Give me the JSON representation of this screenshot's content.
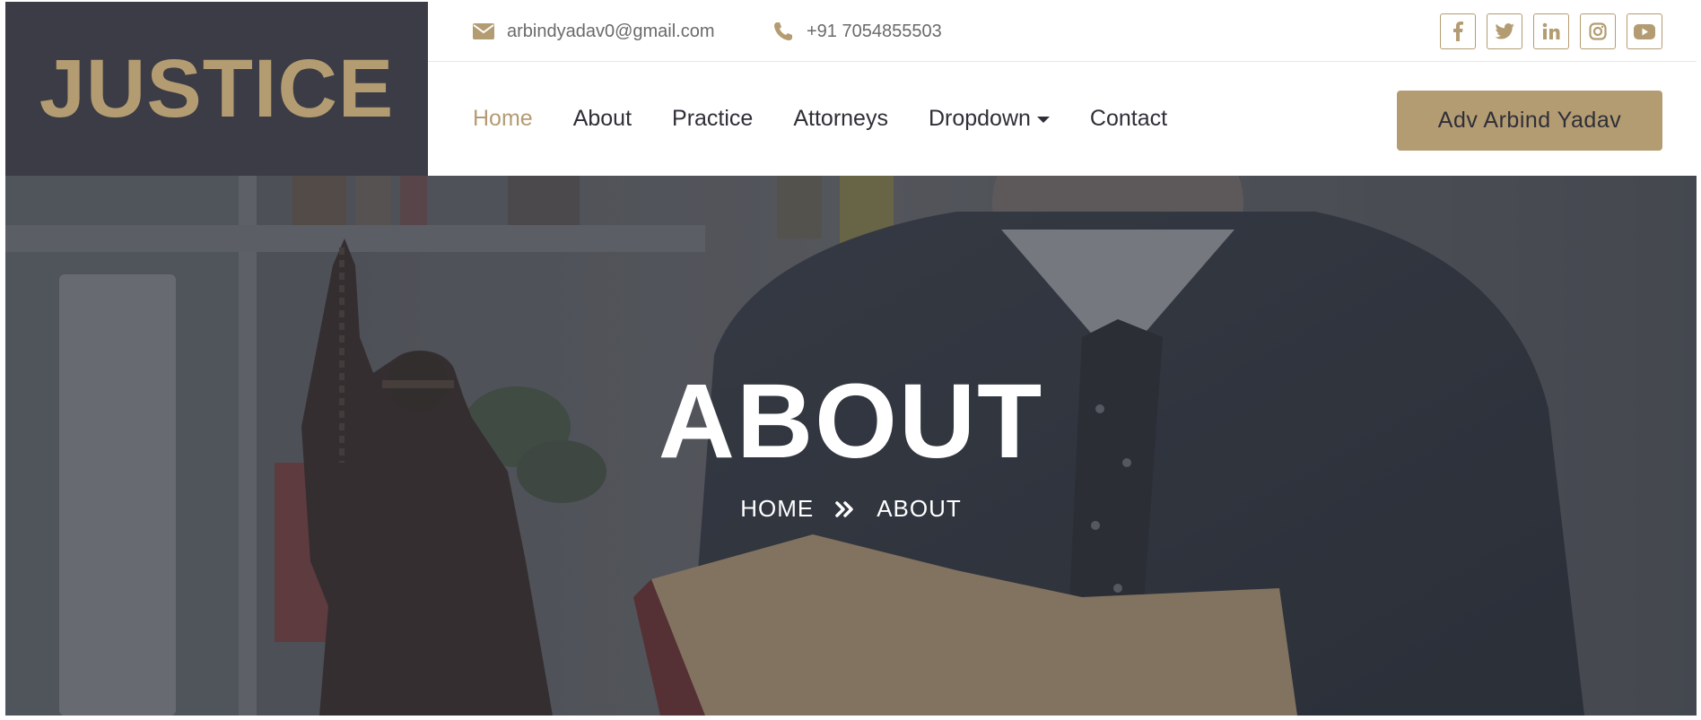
{
  "brand": {
    "name": "JUSTICE"
  },
  "topbar": {
    "email": "arbindyadav0@gmail.com",
    "phone": "+91 7054855503",
    "email_icon": "envelope-icon",
    "phone_icon": "phone-icon",
    "socials": [
      "facebook-icon",
      "twitter-icon",
      "linkedin-icon",
      "instagram-icon",
      "youtube-icon"
    ]
  },
  "nav": {
    "items": [
      {
        "label": "Home",
        "active": true
      },
      {
        "label": "About"
      },
      {
        "label": "Practice"
      },
      {
        "label": "Attorneys"
      },
      {
        "label": "Dropdown",
        "has_caret": true
      },
      {
        "label": "Contact"
      }
    ],
    "cta_label": "Adv Arbind Yadav"
  },
  "hero": {
    "title": "ABOUT",
    "breadcrumb": [
      "HOME",
      "ABOUT"
    ],
    "separator_icon": "double-chevron-right-icon"
  },
  "colors": {
    "accent": "#b49c72",
    "brand_bg": "#3b3c45",
    "nav_text": "#2f2f38"
  }
}
